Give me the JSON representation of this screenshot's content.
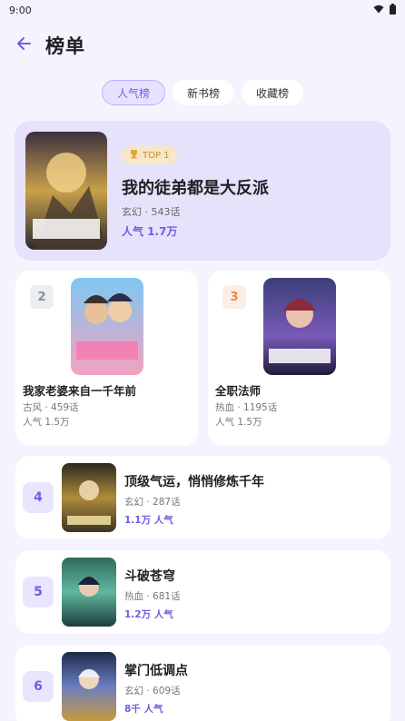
{
  "status_bar": {
    "time": "9:00",
    "wifi_icon": "wifi-icon",
    "battery_icon": "battery-icon"
  },
  "header": {
    "title": "榜单",
    "back_icon": "arrow-left-icon"
  },
  "tabs": [
    {
      "label": "人气榜",
      "active": true
    },
    {
      "label": "新书榜",
      "active": false
    },
    {
      "label": "收藏榜",
      "active": false
    }
  ],
  "colors": {
    "accent": "#6b5fe3",
    "gold": "#c58e25",
    "page_bg": "#f5f3fd"
  },
  "rank1": {
    "badge": "TOP 1",
    "badge_icon": "trophy-icon",
    "title": "我的徒弟都是大反派",
    "meta": "玄幻 · 543话",
    "popularity": "人气 1.7万"
  },
  "rank2": {
    "rank": "2",
    "title": "我家老婆来自一千年前",
    "meta": "古风 · 459话",
    "popularity": "人气 1.5万"
  },
  "rank3": {
    "rank": "3",
    "title": "全职法师",
    "meta": "热血 · 1195话",
    "popularity": "人气 1.5万"
  },
  "list": [
    {
      "rank": "4",
      "title": "顶级气运，悄悄修炼千年",
      "meta": "玄幻 · 287话",
      "popularity": "1.1万 人气"
    },
    {
      "rank": "5",
      "title": "斗破苍穹",
      "meta": "热血 · 681话",
      "popularity": "1.2万 人气"
    },
    {
      "rank": "6",
      "title": "掌门低调点",
      "meta": "玄幻 · 609话",
      "popularity": "8千 人气"
    }
  ]
}
